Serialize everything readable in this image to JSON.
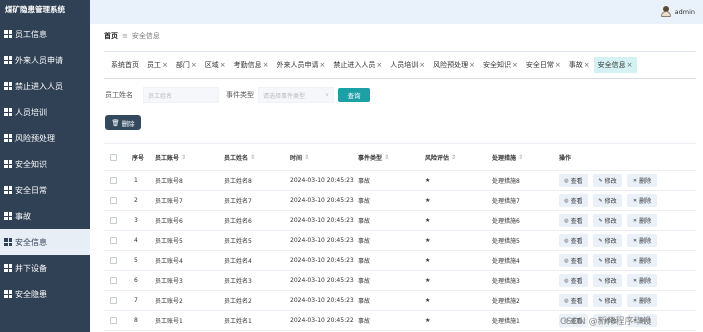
{
  "app": {
    "title": "煤矿隐患管理系统"
  },
  "user": {
    "name": "admin"
  },
  "sidebar": {
    "items": [
      {
        "label": "员工信息"
      },
      {
        "label": "外来人员申请"
      },
      {
        "label": "禁止进入人员"
      },
      {
        "label": "人员培训"
      },
      {
        "label": "风险预处理"
      },
      {
        "label": "安全知识"
      },
      {
        "label": "安全日常"
      },
      {
        "label": "事故"
      },
      {
        "label": "安全信息",
        "active": true
      },
      {
        "label": "井下设备"
      },
      {
        "label": "安全隐患"
      }
    ]
  },
  "breadcrumb": {
    "home": "首页",
    "separator": "≡",
    "current": "安全信息"
  },
  "tags": [
    {
      "label": "系统首页",
      "closable": false
    },
    {
      "label": "员工",
      "closable": true
    },
    {
      "label": "部门",
      "closable": true
    },
    {
      "label": "区域",
      "closable": true
    },
    {
      "label": "考勤信息",
      "closable": true
    },
    {
      "label": "外来人员申请",
      "closable": true
    },
    {
      "label": "禁止进入人员",
      "closable": true
    },
    {
      "label": "人员培训",
      "closable": true
    },
    {
      "label": "风险预处理",
      "closable": true
    },
    {
      "label": "安全知识",
      "closable": true
    },
    {
      "label": "安全日常",
      "closable": true
    },
    {
      "label": "事故",
      "closable": true
    },
    {
      "label": "安全信息",
      "closable": true,
      "active": true
    }
  ],
  "search": {
    "name_label": "员工姓名",
    "name_placeholder": "员工姓名",
    "type_label": "事件类型",
    "type_placeholder": "请选择事件类型",
    "query_button": "查询"
  },
  "toolbar": {
    "delete_label": "删除"
  },
  "table": {
    "headers": [
      "序号",
      "员工账号",
      "员工姓名",
      "时间",
      "事件类型",
      "风险评估",
      "处理措施",
      "操作"
    ],
    "action_labels": {
      "view": "查看",
      "edit": "修改",
      "delete": "删除"
    },
    "rows": [
      [
        "1",
        "员工账号8",
        "员工姓名8",
        "2024-03-10 20:45:23",
        "事故",
        "★",
        "处理措施8"
      ],
      [
        "2",
        "员工账号7",
        "员工姓名7",
        "2024-03-10 20:45:23",
        "事故",
        "★",
        "处理措施7"
      ],
      [
        "3",
        "员工账号6",
        "员工姓名6",
        "2024-03-10 20:45:23",
        "事故",
        "★",
        "处理措施6"
      ],
      [
        "4",
        "员工账号5",
        "员工姓名5",
        "2024-03-10 20:45:23",
        "事故",
        "★",
        "处理措施5"
      ],
      [
        "5",
        "员工账号4",
        "员工姓名4",
        "2024-03-10 20:45:23",
        "事故",
        "★",
        "处理措施4"
      ],
      [
        "6",
        "员工账号3",
        "员工姓名3",
        "2024-03-10 20:45:23",
        "事故",
        "★",
        "处理措施3"
      ],
      [
        "7",
        "员工账号2",
        "员工姓名2",
        "2024-03-10 20:45:23",
        "事故",
        "★",
        "处理措施2"
      ],
      [
        "8",
        "员工账号1",
        "员工姓名1",
        "2024-03-10 20:45:22",
        "事故",
        "★",
        "处理措施1"
      ]
    ]
  },
  "watermark": "CSDN @新伟程序毕设",
  "colors": {
    "sidebar_bg": "#304156",
    "accent": "#1ba0a6",
    "active_tag_bg": "#d4f1f4",
    "delete_button_bg": "#334a5e"
  }
}
